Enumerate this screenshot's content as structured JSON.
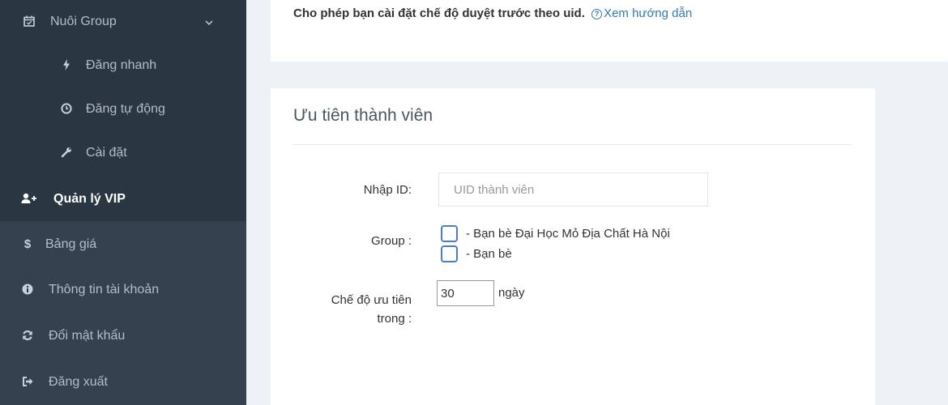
{
  "sidebar": {
    "items": [
      {
        "label": "Nuôi Group",
        "icon": "calendar-check-icon"
      },
      {
        "label": "Đăng nhanh",
        "icon": "bolt-icon"
      },
      {
        "label": "Đăng tự động",
        "icon": "clock-icon"
      },
      {
        "label": "Cài đặt",
        "icon": "wrench-icon"
      },
      {
        "label": "Quản lý VIP",
        "icon": "user-plus-icon"
      },
      {
        "label": "Bảng giá",
        "icon": "dollar-icon"
      },
      {
        "label": "Thông tin tài khoản",
        "icon": "info-circle-icon"
      },
      {
        "label": "Đổi mật khẩu",
        "icon": "refresh-icon"
      },
      {
        "label": "Đăng xuất",
        "icon": "sign-out-icon"
      }
    ]
  },
  "notice": {
    "text": "Cho phép bạn cài đặt chế độ duyệt trước theo uid.",
    "link": "Xem hướng dẫn"
  },
  "form": {
    "title": "Ưu tiên thành viên",
    "uid_label": "Nhập ID:",
    "uid_placeholder": "UID thành viên",
    "group_label": "Group :",
    "groups": [
      {
        "label": "- Bạn bè Đại Học Mỏ Địa Chất Hà Nội",
        "checked": false
      },
      {
        "label": "- Bạn bè",
        "checked": false
      }
    ],
    "priority_label_line1": "Chế độ ưu tiên",
    "priority_label_line2": "trong :",
    "priority_days": "30",
    "days_unit": "ngày"
  },
  "colors": {
    "sidebar_bg": "#2b3643",
    "sidebar_lower_bg": "#364150",
    "link": "#337ab7",
    "checkbox_border": "#4a7cc8"
  }
}
